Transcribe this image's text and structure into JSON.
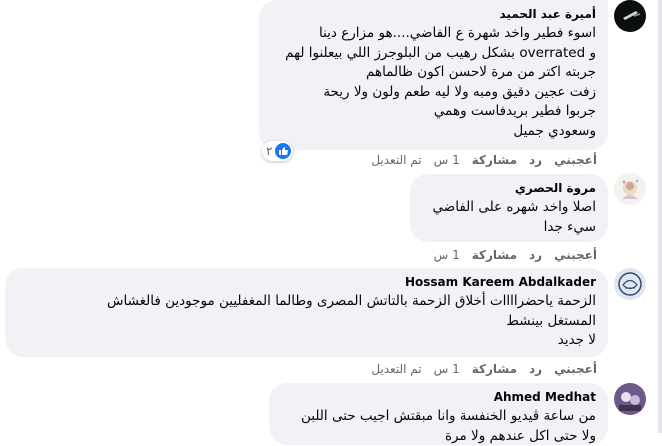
{
  "accent_color": "#1877f2",
  "comments": [
    {
      "author": "أميرة عبد الحميد",
      "lines": [
        "اسوء فطير واخد شهرة ع الفاضي....هو مزارع دينا",
        "و overrated بشكل رهيب من البلوجرز اللي بيعلنوا لهم",
        "جربته اكتر من مرة لاحسن اكون ظالماهم",
        "زفت عجين دقيق ومبه ولا ليه طعم ولون ولا ريحة",
        "جربوا فطير بريدفاست وهمي",
        "وسعودي جميل"
      ],
      "actions": {
        "like": "أعجبني",
        "reply": "رد",
        "share": "مشاركة",
        "time": "1 س",
        "edited": "تم التعديل"
      },
      "reaction_count": "٢",
      "reaction_icon": "like-icon"
    },
    {
      "author": "مروة الحصري",
      "lines": [
        "اصلا واخد شهره على الفاضي",
        "سيء جدا"
      ],
      "actions": {
        "like": "أعجبني",
        "reply": "رد",
        "share": "مشاركة",
        "time": "1 س"
      }
    },
    {
      "author": "Hossam Kareem Abdalkader",
      "lines": [
        "الزحمة ياحضراااات أخلاق الزحمة بالتاتش المصرى وطالما المغفليين موجودين فالغشاش",
        "المستغل بينشط",
        "لا جديد"
      ],
      "actions": {
        "like": "أعجبني",
        "reply": "رد",
        "share": "مشاركة",
        "time": "1 س",
        "edited": "تم التعديل"
      }
    },
    {
      "author": "Ahmed Medhat",
      "lines": [
        "من ساعة ڤيديو الخنفسة وانا مبقتش اجيب حتى اللبن",
        "ولا حتى اكل عندهم ولا مرة"
      ]
    }
  ]
}
